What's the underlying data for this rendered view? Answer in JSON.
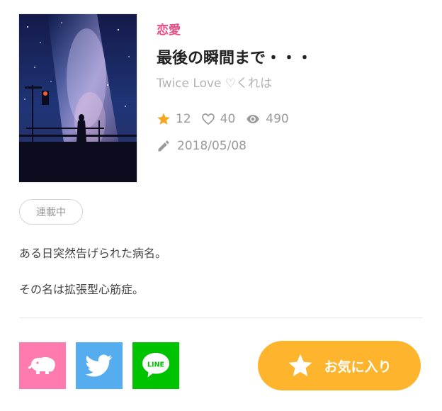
{
  "novel": {
    "genre": "恋愛",
    "title": "最後の瞬間まで・・・",
    "author": "Twice Love ♡くれは",
    "stats": {
      "stars": "12",
      "likes": "40",
      "views": "490"
    },
    "date": "2018/05/08",
    "status": "連載中",
    "summary": [
      "ある日突然告げられた病名。",
      "その名は拡張型心筋症。"
    ]
  },
  "share": {
    "line_label": "LINE"
  },
  "favorite": {
    "label": "お気に入り"
  },
  "colors": {
    "genre": "#ec4b83",
    "star": "#f5a623",
    "favorite_button": "#ffb42e",
    "pink_share": "#ff7aae",
    "twitter": "#55acee",
    "line": "#00c300"
  },
  "icons": {
    "stars": "star-icon",
    "likes": "heart-icon",
    "views": "eye-icon",
    "date": "pencil-icon",
    "share_pink": "elephant-icon",
    "share_twitter": "twitter-bird-icon",
    "share_line": "line-logo-icon",
    "favorite": "star-icon"
  }
}
